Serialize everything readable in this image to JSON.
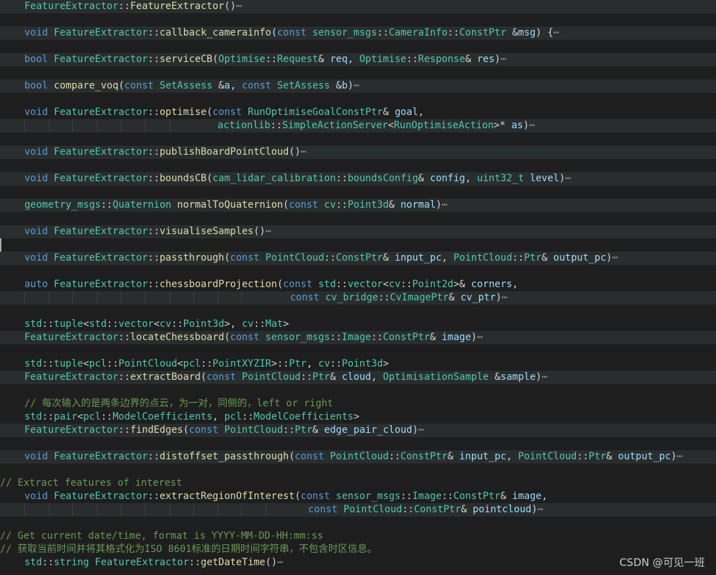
{
  "colors": {
    "background": "#1e1e1e",
    "fold_highlight": "#2a2d2e",
    "keyword": "#569cd6",
    "type": "#4ec9b0",
    "function": "#dcdcaa",
    "variable": "#9cdcfe",
    "comment": "#6a9955"
  },
  "fold_indicator": "⋯",
  "watermark": "CSDN @可见一班",
  "lines": [
    {
      "fold": true,
      "tokens": [
        [
          "ty",
          "FeatureExtractor"
        ],
        [
          "pun",
          "::"
        ],
        [
          "fn",
          "FeatureExtractor"
        ],
        [
          "pun",
          "()"
        ]
      ],
      "folded": true
    },
    {
      "blank": true
    },
    {
      "fold": true,
      "tokens": [
        [
          "kw",
          "void "
        ],
        [
          "ty",
          "FeatureExtractor"
        ],
        [
          "pun",
          "::"
        ],
        [
          "fn",
          "callback_camerainfo"
        ],
        [
          "pun",
          "("
        ],
        [
          "kw",
          "const "
        ],
        [
          "ty",
          "sensor_msgs"
        ],
        [
          "pun",
          "::"
        ],
        [
          "ty",
          "CameraInfo"
        ],
        [
          "pun",
          "::"
        ],
        [
          "ty",
          "ConstPtr "
        ],
        [
          "pun",
          "&"
        ],
        [
          "var",
          "msg"
        ],
        [
          "pun",
          ") {"
        ]
      ],
      "folded": true
    },
    {
      "blank": true
    },
    {
      "fold": true,
      "tokens": [
        [
          "kw",
          "bool "
        ],
        [
          "ty",
          "FeatureExtractor"
        ],
        [
          "pun",
          "::"
        ],
        [
          "fn",
          "serviceCB"
        ],
        [
          "pun",
          "("
        ],
        [
          "ty",
          "Optimise"
        ],
        [
          "pun",
          "::"
        ],
        [
          "ty",
          "Request"
        ],
        [
          "pun",
          "& "
        ],
        [
          "var",
          "req"
        ],
        [
          "pun",
          ", "
        ],
        [
          "ty",
          "Optimise"
        ],
        [
          "pun",
          "::"
        ],
        [
          "ty",
          "Response"
        ],
        [
          "pun",
          "& "
        ],
        [
          "var",
          "res"
        ],
        [
          "pun",
          ")"
        ]
      ],
      "folded": true
    },
    {
      "blank": true
    },
    {
      "fold": true,
      "tokens": [
        [
          "kw",
          "bool "
        ],
        [
          "fn",
          "compare_voq"
        ],
        [
          "pun",
          "("
        ],
        [
          "kw",
          "const "
        ],
        [
          "ty",
          "SetAssess "
        ],
        [
          "pun",
          "&"
        ],
        [
          "var",
          "a"
        ],
        [
          "pun",
          ", "
        ],
        [
          "kw",
          "const "
        ],
        [
          "ty",
          "SetAssess "
        ],
        [
          "pun",
          "&"
        ],
        [
          "var",
          "b"
        ],
        [
          "pun",
          ")"
        ]
      ],
      "folded": true
    },
    {
      "blank": true
    },
    {
      "tokens": [
        [
          "kw",
          "void "
        ],
        [
          "ty",
          "FeatureExtractor"
        ],
        [
          "pun",
          "::"
        ],
        [
          "fn",
          "optimise"
        ],
        [
          "pun",
          "("
        ],
        [
          "kw",
          "const "
        ],
        [
          "ty",
          "RunOptimiseGoalConstPtr"
        ],
        [
          "pun",
          "& "
        ],
        [
          "var",
          "goal"
        ],
        [
          "pun",
          ","
        ]
      ]
    },
    {
      "fold": true,
      "guides": 7,
      "indent": 312,
      "tokens": [
        [
          "ty",
          "actionlib"
        ],
        [
          "pun",
          "::"
        ],
        [
          "ty",
          "SimpleActionServer"
        ],
        [
          "pun",
          "<"
        ],
        [
          "ty",
          "RunOptimiseAction"
        ],
        [
          "pun",
          ">* "
        ],
        [
          "var",
          "as"
        ],
        [
          "pun",
          ")"
        ]
      ],
      "folded": true
    },
    {
      "blank": true
    },
    {
      "fold": true,
      "tokens": [
        [
          "kw",
          "void "
        ],
        [
          "ty",
          "FeatureExtractor"
        ],
        [
          "pun",
          "::"
        ],
        [
          "fn",
          "publishBoardPointCloud"
        ],
        [
          "pun",
          "()"
        ]
      ],
      "folded": true
    },
    {
      "blank": true
    },
    {
      "fold": true,
      "tokens": [
        [
          "kw",
          "void "
        ],
        [
          "ty",
          "FeatureExtractor"
        ],
        [
          "pun",
          "::"
        ],
        [
          "fn",
          "boundsCB"
        ],
        [
          "pun",
          "("
        ],
        [
          "ty",
          "cam_lidar_calibration"
        ],
        [
          "pun",
          "::"
        ],
        [
          "ty",
          "boundsConfig"
        ],
        [
          "pun",
          "& "
        ],
        [
          "var",
          "config"
        ],
        [
          "pun",
          ", "
        ],
        [
          "ty",
          "uint32_t "
        ],
        [
          "var",
          "level"
        ],
        [
          "pun",
          ")"
        ]
      ],
      "folded": true
    },
    {
      "blank": true
    },
    {
      "fold": true,
      "tokens": [
        [
          "ty",
          "geometry_msgs"
        ],
        [
          "pun",
          "::"
        ],
        [
          "ty",
          "Quaternion "
        ],
        [
          "fn",
          "normalToQuaternion"
        ],
        [
          "pun",
          "("
        ],
        [
          "kw",
          "const "
        ],
        [
          "ty",
          "cv"
        ],
        [
          "pun",
          "::"
        ],
        [
          "ty",
          "Point3d"
        ],
        [
          "pun",
          "& "
        ],
        [
          "var",
          "normal"
        ],
        [
          "pun",
          ")"
        ]
      ],
      "folded": true
    },
    {
      "blank": true
    },
    {
      "fold": true,
      "tokens": [
        [
          "kw",
          "void "
        ],
        [
          "ty",
          "FeatureExtractor"
        ],
        [
          "pun",
          "::"
        ],
        [
          "fn",
          "visualiseSamples"
        ],
        [
          "pun",
          "()"
        ]
      ],
      "folded": true
    },
    {
      "blank": true,
      "cursor": true
    },
    {
      "fold": true,
      "tokens": [
        [
          "kw",
          "void "
        ],
        [
          "ty",
          "FeatureExtractor"
        ],
        [
          "pun",
          "::"
        ],
        [
          "fn",
          "passthrough"
        ],
        [
          "pun",
          "("
        ],
        [
          "kw",
          "const "
        ],
        [
          "ty",
          "PointCloud"
        ],
        [
          "pun",
          "::"
        ],
        [
          "ty",
          "ConstPtr"
        ],
        [
          "pun",
          "& "
        ],
        [
          "var",
          "input_pc"
        ],
        [
          "pun",
          ", "
        ],
        [
          "ty",
          "PointCloud"
        ],
        [
          "pun",
          "::"
        ],
        [
          "ty",
          "Ptr"
        ],
        [
          "pun",
          "& "
        ],
        [
          "var",
          "output_pc"
        ],
        [
          "pun",
          ")"
        ]
      ],
      "folded": true
    },
    {
      "blank": true
    },
    {
      "tokens": [
        [
          "kw",
          "auto "
        ],
        [
          "ty",
          "FeatureExtractor"
        ],
        [
          "pun",
          "::"
        ],
        [
          "fn",
          "chessboardProjection"
        ],
        [
          "pun",
          "("
        ],
        [
          "kw",
          "const "
        ],
        [
          "ty",
          "std"
        ],
        [
          "pun",
          "::"
        ],
        [
          "ty",
          "vector"
        ],
        [
          "pun",
          "<"
        ],
        [
          "ty",
          "cv"
        ],
        [
          "pun",
          "::"
        ],
        [
          "ty",
          "Point2d"
        ],
        [
          "pun",
          ">& "
        ],
        [
          "var",
          "corners"
        ],
        [
          "pun",
          ","
        ]
      ]
    },
    {
      "fold": true,
      "guides": 10,
      "indent": 416,
      "tokens": [
        [
          "kw",
          "const "
        ],
        [
          "ty",
          "cv_bridge"
        ],
        [
          "pun",
          "::"
        ],
        [
          "ty",
          "CvImagePtr"
        ],
        [
          "pun",
          "& "
        ],
        [
          "var",
          "cv_ptr"
        ],
        [
          "pun",
          ")"
        ]
      ],
      "folded": true
    },
    {
      "blank": true
    },
    {
      "tokens": [
        [
          "ty",
          "std"
        ],
        [
          "pun",
          "::"
        ],
        [
          "ty",
          "tuple"
        ],
        [
          "pun",
          "<"
        ],
        [
          "ty",
          "std"
        ],
        [
          "pun",
          "::"
        ],
        [
          "ty",
          "vector"
        ],
        [
          "pun",
          "<"
        ],
        [
          "ty",
          "cv"
        ],
        [
          "pun",
          "::"
        ],
        [
          "ty",
          "Point3d"
        ],
        [
          "pun",
          ">, "
        ],
        [
          "ty",
          "cv"
        ],
        [
          "pun",
          "::"
        ],
        [
          "ty",
          "Mat"
        ],
        [
          "pun",
          ">"
        ]
      ]
    },
    {
      "fold": true,
      "tokens": [
        [
          "ty",
          "FeatureExtractor"
        ],
        [
          "pun",
          "::"
        ],
        [
          "fn",
          "locateChessboard"
        ],
        [
          "pun",
          "("
        ],
        [
          "kw",
          "const "
        ],
        [
          "ty",
          "sensor_msgs"
        ],
        [
          "pun",
          "::"
        ],
        [
          "ty",
          "Image"
        ],
        [
          "pun",
          "::"
        ],
        [
          "ty",
          "ConstPtr"
        ],
        [
          "pun",
          "& "
        ],
        [
          "var",
          "image"
        ],
        [
          "pun",
          ")"
        ]
      ],
      "folded": true
    },
    {
      "blank": true
    },
    {
      "tokens": [
        [
          "ty",
          "std"
        ],
        [
          "pun",
          "::"
        ],
        [
          "ty",
          "tuple"
        ],
        [
          "pun",
          "<"
        ],
        [
          "ty",
          "pcl"
        ],
        [
          "pun",
          "::"
        ],
        [
          "ty",
          "PointCloud"
        ],
        [
          "pun",
          "<"
        ],
        [
          "ty",
          "pcl"
        ],
        [
          "pun",
          "::"
        ],
        [
          "ty",
          "PointXYZIR"
        ],
        [
          "pun",
          ">::"
        ],
        [
          "ty",
          "Ptr"
        ],
        [
          "pun",
          ", "
        ],
        [
          "ty",
          "cv"
        ],
        [
          "pun",
          "::"
        ],
        [
          "ty",
          "Point3d"
        ],
        [
          "pun",
          ">"
        ]
      ]
    },
    {
      "fold": true,
      "tokens": [
        [
          "ty",
          "FeatureExtractor"
        ],
        [
          "pun",
          "::"
        ],
        [
          "fn",
          "extractBoard"
        ],
        [
          "pun",
          "("
        ],
        [
          "kw",
          "const "
        ],
        [
          "ty",
          "PointCloud"
        ],
        [
          "pun",
          "::"
        ],
        [
          "ty",
          "Ptr"
        ],
        [
          "pun",
          "& "
        ],
        [
          "var",
          "cloud"
        ],
        [
          "pun",
          ", "
        ],
        [
          "ty",
          "OptimisationSample "
        ],
        [
          "pun",
          "&"
        ],
        [
          "var",
          "sample"
        ],
        [
          "pun",
          ")"
        ]
      ],
      "folded": true
    },
    {
      "blank": true
    },
    {
      "tokens": [
        [
          "cm",
          "// 每次输入的是两条边界的点云，为一对，同侧的，left or right"
        ]
      ]
    },
    {
      "tokens": [
        [
          "ty",
          "std"
        ],
        [
          "pun",
          "::"
        ],
        [
          "ty",
          "pair"
        ],
        [
          "pun",
          "<"
        ],
        [
          "ty",
          "pcl"
        ],
        [
          "pun",
          "::"
        ],
        [
          "ty",
          "ModelCoefficients"
        ],
        [
          "pun",
          ", "
        ],
        [
          "ty",
          "pcl"
        ],
        [
          "pun",
          "::"
        ],
        [
          "ty",
          "ModelCoefficients"
        ],
        [
          "pun",
          ">"
        ]
      ]
    },
    {
      "fold": true,
      "tokens": [
        [
          "ty",
          "FeatureExtractor"
        ],
        [
          "pun",
          "::"
        ],
        [
          "fn",
          "findEdges"
        ],
        [
          "pun",
          "("
        ],
        [
          "kw",
          "const "
        ],
        [
          "ty",
          "PointCloud"
        ],
        [
          "pun",
          "::"
        ],
        [
          "ty",
          "Ptr"
        ],
        [
          "pun",
          "& "
        ],
        [
          "var",
          "edge_pair_cloud"
        ],
        [
          "pun",
          ")"
        ]
      ],
      "folded": true
    },
    {
      "blank": true
    },
    {
      "fold": true,
      "tokens": [
        [
          "kw",
          "void "
        ],
        [
          "ty",
          "FeatureExtractor"
        ],
        [
          "pun",
          "::"
        ],
        [
          "fn",
          "distoffset_passthrough"
        ],
        [
          "pun",
          "("
        ],
        [
          "kw",
          "const "
        ],
        [
          "ty",
          "PointCloud"
        ],
        [
          "pun",
          "::"
        ],
        [
          "ty",
          "ConstPtr"
        ],
        [
          "pun",
          "& "
        ],
        [
          "var",
          "input_pc"
        ],
        [
          "pun",
          ", "
        ],
        [
          "ty",
          "PointCloud"
        ],
        [
          "pun",
          "::"
        ],
        [
          "ty",
          "Ptr"
        ],
        [
          "pun",
          "& "
        ],
        [
          "var",
          "output_pc"
        ],
        [
          "pun",
          ")"
        ]
      ],
      "folded": true
    },
    {
      "blank": true
    },
    {
      "col0": true,
      "tokens": [
        [
          "cm",
          "// Extract features of interest"
        ]
      ]
    },
    {
      "tokens": [
        [
          "kw",
          "void "
        ],
        [
          "ty",
          "FeatureExtractor"
        ],
        [
          "pun",
          "::"
        ],
        [
          "fn",
          "extractRegionOfInterest"
        ],
        [
          "pun",
          "("
        ],
        [
          "kw",
          "const "
        ],
        [
          "ty",
          "sensor_msgs"
        ],
        [
          "pun",
          "::"
        ],
        [
          "ty",
          "Image"
        ],
        [
          "pun",
          "::"
        ],
        [
          "ty",
          "ConstPtr"
        ],
        [
          "pun",
          "& "
        ],
        [
          "var",
          "image"
        ],
        [
          "pun",
          ","
        ]
      ]
    },
    {
      "fold": true,
      "guides": 11,
      "indent": 442,
      "tokens": [
        [
          "kw",
          "const "
        ],
        [
          "ty",
          "PointCloud"
        ],
        [
          "pun",
          "::"
        ],
        [
          "ty",
          "ConstPtr"
        ],
        [
          "pun",
          "& "
        ],
        [
          "var",
          "pointcloud"
        ],
        [
          "pun",
          ")"
        ]
      ],
      "folded": true
    },
    {
      "blank": true
    },
    {
      "col0": true,
      "tokens": [
        [
          "cm",
          "// Get current date/time, format is YYYY-MM-DD-HH:mm:ss"
        ]
      ]
    },
    {
      "col0": true,
      "tokens": [
        [
          "cm",
          "// 获取当前时间并将其格式化为ISO 8601标准的日期时间字符串，不包含时区信息。"
        ]
      ]
    },
    {
      "tokens": [
        [
          "ty",
          "std"
        ],
        [
          "pun",
          "::"
        ],
        [
          "ty",
          "string "
        ],
        [
          "ty",
          "FeatureExtractor"
        ],
        [
          "pun",
          "::"
        ],
        [
          "fn",
          "getDateTime"
        ],
        [
          "pun",
          "()"
        ]
      ],
      "folded": true
    }
  ]
}
